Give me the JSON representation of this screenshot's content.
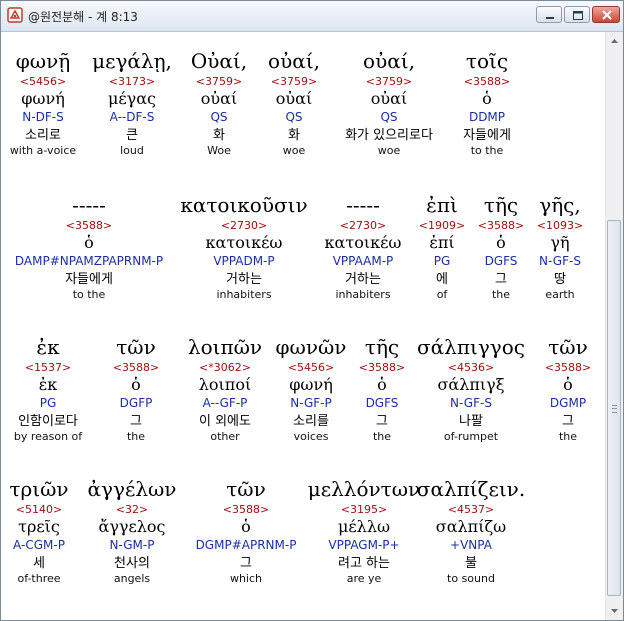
{
  "window": {
    "title": "@원전분해 - 계 8:13"
  },
  "rows": [
    [
      {
        "greek": "φωνῇ",
        "strong": "<5456>",
        "lemma": "φωνή",
        "parse": "N-DF-S",
        "korean": "소리로",
        "english": "with a-voice"
      },
      {
        "greek": "μεγάλῃ,",
        "strong": "<3173>",
        "lemma": "μέγας",
        "parse": "A--DF-S",
        "korean": "큰",
        "english": "loud"
      },
      {
        "greek": "Οὐαί,",
        "strong": "<3759>",
        "lemma": "οὐαί",
        "parse": "QS",
        "korean": "화",
        "english": "Woe"
      },
      {
        "greek": "οὐαί,",
        "strong": "<3759>",
        "lemma": "οὐαί",
        "parse": "QS",
        "korean": "화",
        "english": "woe"
      },
      {
        "greek": "οὐαί,",
        "strong": "<3759>",
        "lemma": "οὐαί",
        "parse": "QS",
        "korean": "화가 있으리로다",
        "english": "woe"
      },
      {
        "greek": "τοῖς",
        "strong": "<3588>",
        "lemma": "ὁ",
        "parse": "DDMP",
        "korean": "자들에게",
        "english": "to the"
      }
    ],
    [
      {
        "greek": "-----",
        "strong": "<3588>",
        "lemma": "ὁ",
        "parse": "DAMP#NPAMZPAPRNM-P",
        "korean": "자들에게",
        "english": "to the"
      },
      {
        "greek": "κατοικοῦσιν",
        "strong": "<2730>",
        "lemma": "κατοικέω",
        "parse": "VPPADM-P",
        "korean": "거하는",
        "english": "inhabiters"
      },
      {
        "greek": "-----",
        "strong": "<2730>",
        "lemma": "κατοικέω",
        "parse": "VPPAAM-P",
        "korean": "거하는",
        "english": "inhabiters"
      },
      {
        "greek": "ἐπὶ",
        "strong": "<1909>",
        "lemma": "ἐπί",
        "parse": "PG",
        "korean": "에",
        "english": "of"
      },
      {
        "greek": "τῆς",
        "strong": "<3588>",
        "lemma": "ὁ",
        "parse": "DGFS",
        "korean": "그",
        "english": "the"
      },
      {
        "greek": "γῆς,",
        "strong": "<1093>",
        "lemma": "γῆ",
        "parse": "N-GF-S",
        "korean": "땅",
        "english": "earth"
      }
    ],
    [
      {
        "greek": "ἐκ",
        "strong": "<1537>",
        "lemma": "ἐκ",
        "parse": "PG",
        "korean": "인함이로다",
        "english": "by reason of"
      },
      {
        "greek": "τῶν",
        "strong": "<3588>",
        "lemma": "ὁ",
        "parse": "DGFP",
        "korean": "그",
        "english": "the"
      },
      {
        "greek": "λοιπῶν",
        "strong": "<*3062>",
        "lemma": "λοιποί",
        "parse": "A--GF-P",
        "korean": "이 외에도",
        "english": "other"
      },
      {
        "greek": "φωνῶν",
        "strong": "<5456>",
        "lemma": "φωνή",
        "parse": "N-GF-P",
        "korean": "소리를",
        "english": "voices"
      },
      {
        "greek": "τῆς",
        "strong": "<3588>",
        "lemma": "ὁ",
        "parse": "DGFS",
        "korean": "그",
        "english": "the"
      },
      {
        "greek": "σάλπιγγος",
        "strong": "<4536>",
        "lemma": "σάλπιγξ",
        "parse": "N-GF-S",
        "korean": "나팔",
        "english": "of-rumpet"
      },
      {
        "greek": "τῶν",
        "strong": "<3588>",
        "lemma": "ὁ",
        "parse": "DGMP",
        "korean": "그",
        "english": "the"
      }
    ],
    [
      {
        "greek": "τριῶν",
        "strong": "<5140>",
        "lemma": "τρεῖς",
        "parse": "A-CGM-P",
        "korean": "세",
        "english": "of-three"
      },
      {
        "greek": "ἀγγέλων",
        "strong": "<32>",
        "lemma": "ἄγγελος",
        "parse": "N-GM-P",
        "korean": "천사의",
        "english": "angels"
      },
      {
        "greek": "τῶν",
        "strong": "<3588>",
        "lemma": "ὁ",
        "parse": "DGMP#APRNM-P",
        "korean": "그",
        "english": "which"
      },
      {
        "greek": "μελλόντων",
        "strong": "<3195>",
        "lemma": "μέλλω",
        "parse": "VPPAGM-P+",
        "korean": "려고 하는",
        "english": "are ye"
      },
      {
        "greek": "σαλπίζειν.",
        "strong": "<4537>",
        "lemma": "σαλπίζω",
        "parse": "+VNPA",
        "korean": "불",
        "english": "to sound"
      }
    ]
  ]
}
